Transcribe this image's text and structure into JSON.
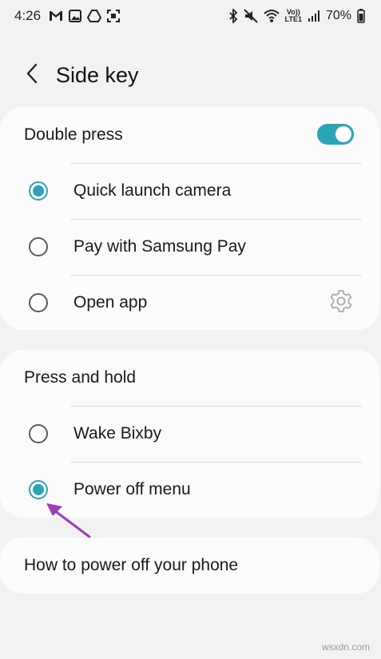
{
  "status_bar": {
    "time": "4:26",
    "left_icons": [
      "gmail-icon",
      "gallery-icon",
      "drive-icon",
      "screenshot-icon"
    ],
    "right_icons": [
      "bluetooth-icon",
      "mute-icon",
      "wifi-icon",
      "volte-icon",
      "signal-icon"
    ],
    "volte_line1": "Vo))",
    "volte_line2": "LTE1",
    "battery_percent": "70%"
  },
  "header": {
    "title": "Side key"
  },
  "double_press": {
    "label": "Double press",
    "enabled": true,
    "options": [
      {
        "label": "Quick launch camera",
        "selected": true
      },
      {
        "label": "Pay with Samsung Pay",
        "selected": false
      },
      {
        "label": "Open app",
        "selected": false
      }
    ]
  },
  "press_and_hold": {
    "label": "Press and hold",
    "options": [
      {
        "label": "Wake Bixby",
        "selected": false
      },
      {
        "label": "Power off menu",
        "selected": true
      }
    ]
  },
  "help_link": {
    "label": "How to power off your phone"
  },
  "watermark": "wsxdn.com",
  "colors": {
    "accent": "#2ba3b8",
    "annotation_arrow": "#9b3fb5",
    "background": "#f2f2f2",
    "card": "#fbfbfb"
  }
}
